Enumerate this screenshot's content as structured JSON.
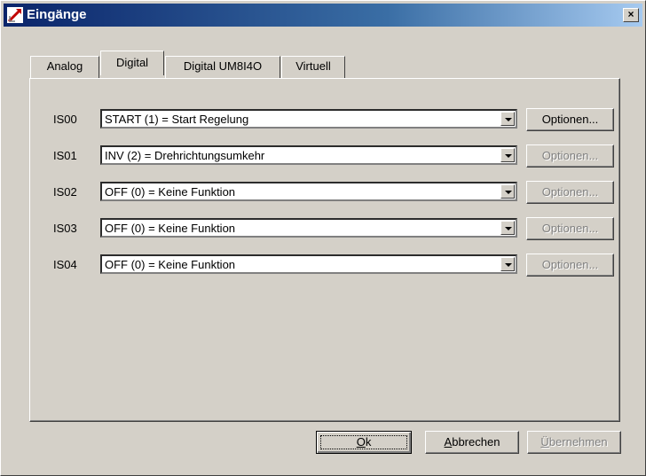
{
  "window": {
    "title": "Eingänge",
    "close_label": "×"
  },
  "tabs": [
    {
      "label": "Analog",
      "active": false
    },
    {
      "label": "Digital",
      "active": true
    },
    {
      "label": "Digital UM8I4O",
      "active": false
    },
    {
      "label": "Virtuell",
      "active": false
    }
  ],
  "rows": [
    {
      "label": "IS00",
      "value": "START (1) = Start Regelung",
      "options_label": "Optionen...",
      "options_enabled": true
    },
    {
      "label": "IS01",
      "value": "INV (2) = Drehrichtungsumkehr",
      "options_label": "Optionen...",
      "options_enabled": false
    },
    {
      "label": "IS02",
      "value": "OFF (0) = Keine Funktion",
      "options_label": "Optionen...",
      "options_enabled": false
    },
    {
      "label": "IS03",
      "value": "OFF (0) = Keine Funktion",
      "options_label": "Optionen...",
      "options_enabled": false
    },
    {
      "label": "IS04",
      "value": "OFF (0) = Keine Funktion",
      "options_label": "Optionen...",
      "options_enabled": false
    }
  ],
  "buttons": {
    "ok": {
      "accel": "O",
      "rest": "k"
    },
    "cancel": {
      "accel": "A",
      "rest": "bbrechen"
    },
    "apply": {
      "accel": "Ü",
      "rest": "bernehmen"
    }
  },
  "colors": {
    "titlebar_start": "#0a246a",
    "titlebar_end": "#a6caf0",
    "face": "#d4d0c8"
  }
}
